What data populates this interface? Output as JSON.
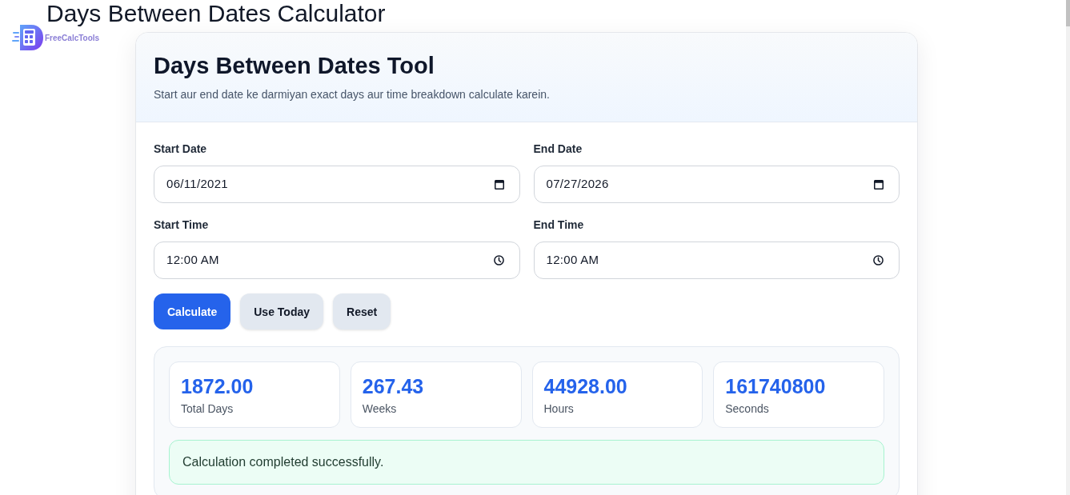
{
  "page_title": "Days Between Dates Calculator",
  "logo": {
    "text": "FreeCalcTools"
  },
  "card": {
    "title": "Days Between Dates Tool",
    "subtitle": "Start aur end date ke darmiyan exact days aur time breakdown calculate karein."
  },
  "fields": [
    {
      "kind": "date",
      "label": "Start Date",
      "value": "06/11/2021"
    },
    {
      "kind": "date",
      "label": "End Date",
      "value": "07/27/2026"
    },
    {
      "kind": "time",
      "label": "Start Time",
      "value": "12:00 AM"
    },
    {
      "kind": "time",
      "label": "End Time",
      "value": "12:00 AM"
    }
  ],
  "buttons": [
    {
      "kind": "primary",
      "label": "Calculate"
    },
    {
      "kind": "secondary",
      "label": "Use Today"
    },
    {
      "kind": "secondary",
      "label": "Reset"
    }
  ],
  "stats": [
    {
      "value": "1872.00",
      "label": "Total Days"
    },
    {
      "value": "267.43",
      "label": "Weeks"
    },
    {
      "value": "44928.00",
      "label": "Hours"
    },
    {
      "value": "161740800",
      "label": "Seconds"
    }
  ],
  "message": {
    "kind": "success",
    "text": "Calculation completed successfully."
  }
}
